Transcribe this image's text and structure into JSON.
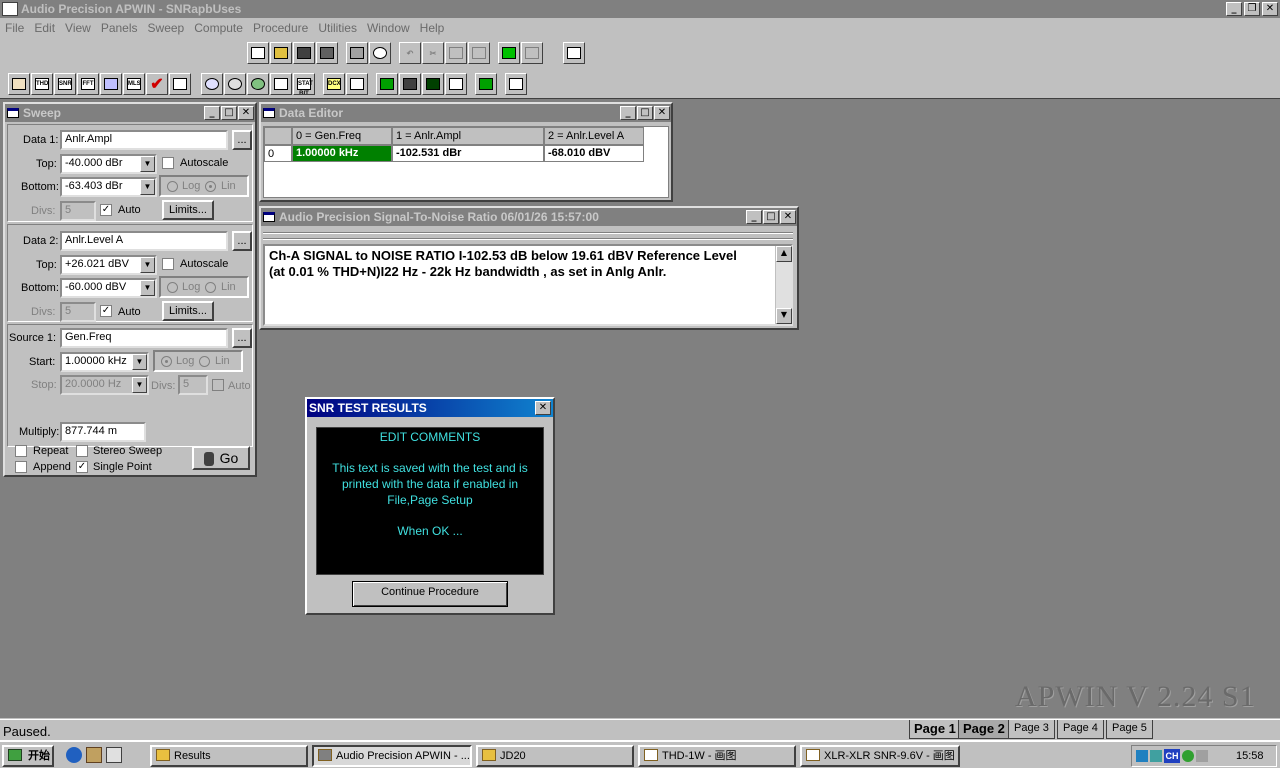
{
  "app": {
    "title": "Audio Precision APWIN - SNRapbUses"
  },
  "menu": [
    "File",
    "Edit",
    "View",
    "Panels",
    "Sweep",
    "Compute",
    "Procedure",
    "Utilities",
    "Window",
    "Help"
  ],
  "toolbar2_labels": [
    "THD",
    "SNR",
    "FFT",
    "MLS",
    "STAT BIT",
    "DCX"
  ],
  "sweep": {
    "title": "Sweep",
    "data1_label": "Data 1:",
    "data1_value": "Anlr.Ampl",
    "top_label": "Top:",
    "top1_value": "-40.000  dBr",
    "bottom_label": "Bottom:",
    "bottom1_value": "-63.403  dBr",
    "log_label": "Log",
    "lin_label": "Lin",
    "autoscale_label": "Autoscale",
    "divs_label": "Divs:",
    "divs_value": "5",
    "auto_label": "Auto",
    "limits_label": "Limits...",
    "data2_label": "Data 2:",
    "data2_value": "Anlr.Level A",
    "top2_value": "+26.021  dBV",
    "bottom2_value": "-60.000  dBV",
    "source1_label": "Source 1:",
    "source1_value": "Gen.Freq",
    "start_label": "Start:",
    "start_value": "1.00000 kHz",
    "stop_label": "Stop:",
    "stop_value": "20.0000  Hz",
    "multiply_label": "Multiply:",
    "multiply_value": "877.744 m",
    "repeat_label": "Repeat",
    "stereo_label": "Stereo Sweep",
    "append_label": "Append",
    "single_label": "Single Point",
    "go_label": "Go",
    "ellipsis": "..."
  },
  "data_editor": {
    "title": "Data Editor",
    "headers": [
      "0 = Gen.Freq",
      "1 = Anlr.Ampl",
      "2 = Anlr.Level A"
    ],
    "row_index": "0",
    "cells": [
      "1.00000 kHz",
      "-102.531 dBr",
      "-68.010  dBV"
    ]
  },
  "notes": {
    "title": "Audio Precision    Signal-To-Noise Ratio    06/01/26 15:57:00",
    "line1": "Ch-A SIGNAL to NOISE RATIO I-102.53 dB below 19.61 dBV  Reference Level",
    "line2": "(at 0.01 %  THD+N)I22 Hz - 22k Hz bandwidth , as set in Anlg Anlr."
  },
  "dialog": {
    "title": "SNR TEST RESULTS",
    "heading": "EDIT COMMENTS",
    "body1": "This text is saved with the test and is printed with the data if enabled in File,Page Setup",
    "body2": "When OK ...",
    "button": "Continue Procedure"
  },
  "status": {
    "text": "Paused.",
    "watermark": "APWIN V 2.24  S1"
  },
  "pages": [
    "Page 1",
    "Page 2",
    "Page 3",
    "Page 4",
    "Page 5"
  ],
  "taskbar": {
    "start": "开始",
    "tasks": [
      "Results",
      "Audio Precision APWIN - ...",
      "JD20",
      "THD-1W - 画图",
      "XLR-XLR SNR-9.6V - 画图"
    ],
    "tray_ch": "CH",
    "clock": "15:58"
  },
  "colors": {
    "selected_cell": "#008000",
    "dialog_text": "#40e0e0",
    "dialog_bg": "#000000"
  }
}
